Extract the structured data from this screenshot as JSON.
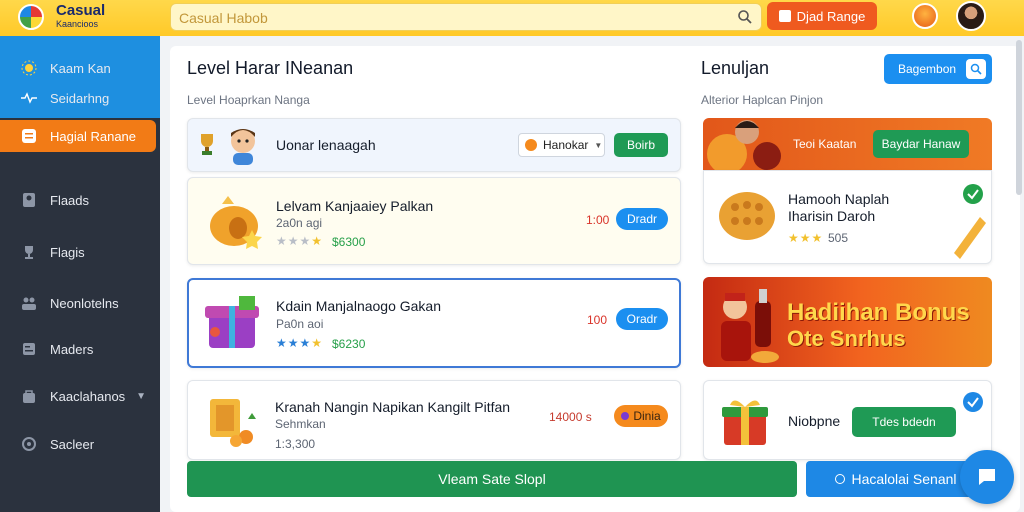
{
  "app": {
    "brand": "Casual",
    "brand_sub": "Kaancioos"
  },
  "search": {
    "placeholder": "Casual Habob"
  },
  "top_button": {
    "label": "Djad Range"
  },
  "sidebar": {
    "items": [
      {
        "label": "Kaam Kan",
        "icon": "sun-icon"
      },
      {
        "label": "Seidarhng",
        "icon": "pulse-icon"
      },
      {
        "label": "Hagial Ranane",
        "icon": "list-icon"
      },
      {
        "label": "Flaads",
        "icon": "user-icon"
      },
      {
        "label": "Flagis",
        "icon": "trophy-icon"
      },
      {
        "label": "Neonlotelns",
        "icon": "people-icon"
      },
      {
        "label": "Maders",
        "icon": "card-icon"
      },
      {
        "label": "Kaaclahanos",
        "icon": "bag-icon"
      },
      {
        "label": "Sacleer",
        "icon": "settings-icon"
      }
    ]
  },
  "left": {
    "title": "Level Harar INeanan",
    "subtitle": "Level Hoaprkan Nanga",
    "header_card": {
      "name": "Uonar lenaagah",
      "select": "Hanokar",
      "button": "Boirb"
    },
    "items": [
      {
        "title": "Lelvam Kanjaaiey Palkan",
        "meta": "2a0n agi",
        "stars": 3,
        "price": "$6300",
        "num": "1:00",
        "action": "Dradr"
      },
      {
        "title": "Kdain Manjalnaogo Gakan",
        "meta": "Pa0n aoi",
        "stars": 4,
        "price": "$6230",
        "num": "100",
        "action": "Oradr"
      },
      {
        "title": "Kranah Nangin Napikan Kangilt Pitfan",
        "meta": "Sehmkan",
        "meta2": "1:3,300",
        "num": "14000 s",
        "action": "Dinia"
      }
    ]
  },
  "right": {
    "title": "Lenuljan",
    "button": "Bagembon",
    "subtitle": "Alterior Haplcan Pinjon",
    "banner": {
      "text": "Teoi Kaatan",
      "button": "Baydar Hanaw"
    },
    "featured": {
      "title": "Hamooh Naplah Iharisin Daroh",
      "rating": "505",
      "stars": 3
    },
    "bonus": {
      "line1": "Hadiihan Bonus",
      "line2": "Ote Snrhus"
    },
    "gift": {
      "label": "Niobpne",
      "button": "Tdes bdedn"
    }
  },
  "bottom": {
    "green_button": "Vleam Sate Slopl",
    "blue_button": "Hacalolai Senanl"
  },
  "colors": {
    "accent": "#f27b16",
    "primary": "#1e88e5",
    "green": "#1f9452",
    "topbar": "#ffc928"
  }
}
